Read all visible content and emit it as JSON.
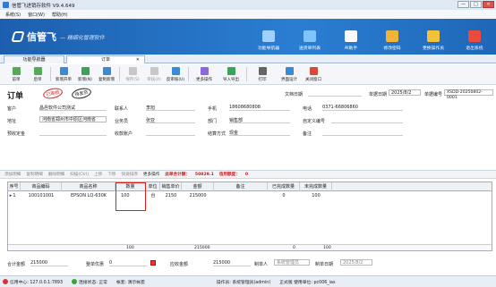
{
  "window": {
    "title": "信管飞进销存软件 V9.4.649",
    "min": "—",
    "max": "□",
    "close": "✕"
  },
  "menu": [
    "系统(S)",
    "窗口(W)",
    "帮助(H)"
  ],
  "banner": {
    "logo": "信管飞",
    "slogan": "— 精细化管理软件"
  },
  "topbuttons": [
    {
      "label": "功能导航器",
      "color": "#9fd0ff"
    },
    {
      "label": "送货单列表",
      "color": "#7fc3ff"
    },
    {
      "label": "AI助手",
      "color": "#ffffff"
    },
    {
      "label": "修改密码",
      "color": "#f3b23a"
    },
    {
      "label": "更换操作员",
      "color": "#f3c23a"
    },
    {
      "label": "退出系统",
      "color": "#e94b3c"
    }
  ],
  "tabs": [
    {
      "label": "功能导航器"
    },
    {
      "label": "订单",
      "close": "✕"
    }
  ],
  "toolbar": [
    {
      "label": "前单",
      "color": "#58a85a",
      "enabled": true
    },
    {
      "label": "后单",
      "color": "#58a85a",
      "enabled": true
    },
    {
      "label": "新增开单",
      "color": "#3a8ad6",
      "enabled": true
    },
    {
      "label": "新增(N)",
      "color": "#3aa35a",
      "enabled": true
    },
    {
      "label": "复制新增",
      "color": "#3a8ad6",
      "enabled": true
    },
    {
      "label": "保存(S)",
      "color": "#bbb",
      "enabled": false
    },
    {
      "label": "审核(A)",
      "color": "#bbb",
      "enabled": false
    },
    {
      "label": "反审核(U)",
      "color": "#3a8ad6",
      "enabled": true
    },
    {
      "label": "更多操作",
      "color": "#8a6ad6",
      "enabled": true
    },
    {
      "label": "导入导出",
      "color": "#3aa35a",
      "enabled": true
    },
    {
      "label": "打印",
      "color": "#666",
      "enabled": true
    },
    {
      "label": "界面设计",
      "color": "#3a8ad6",
      "enabled": true
    },
    {
      "label": "关闭窗口",
      "color": "#d64a3a",
      "enabled": true
    }
  ],
  "form": {
    "title": "订单",
    "stamp_status": "已审核",
    "stamp_type": "待发货",
    "doc_date_label": "文档日期",
    "doc_date_value": "",
    "bill_date_label": "单据日期",
    "bill_date_value": "2025/8/2",
    "bill_no_label": "单据编号",
    "bill_no_value": "XSDD-20250802-0001",
    "customer_label": "客户",
    "customer_value": "昌邑软件公司测试",
    "contact_label": "联系人",
    "contact_value": "李旭",
    "mobile_label": "手机",
    "mobile_value": "18608680808",
    "phone_label": "电话",
    "phone_value": "0371-66806860",
    "address_label": "地址",
    "address_value": "河南省郑州市中原区河南省",
    "salesman_label": "业务员",
    "salesman_value": "张亚",
    "dept_label": "部门",
    "dept_value": "销售部",
    "custom_no_label": "自定义编号",
    "custom_no_value": "",
    "prepay_label": "预收定金",
    "prepay_value": "",
    "account_label": "收款账户",
    "account_value": "",
    "settle_label": "结算方式",
    "settle_value": "现金",
    "remark_label": "备注",
    "remark_value": ""
  },
  "gridtoolbar": {
    "items": [
      "添加明细",
      "复制明细",
      "删除明细",
      "扫描(Ctrl)",
      "上移",
      "下移",
      "快速排序",
      "更多操作"
    ],
    "summary_label": "此单合计额：",
    "summary_value": "50829.1",
    "credit_label": "信用额度：",
    "credit_value": "0"
  },
  "table": {
    "headers": [
      "序号",
      "商品编码",
      "商品名称",
      "数量",
      "单位",
      "销售单价",
      "金额",
      "备注",
      "已完成数量",
      "未完成数量"
    ],
    "rows": [
      {
        "idx": "1",
        "code": "100101001",
        "name": "EPSON LQ-630K",
        "qty": "100",
        "unit": "台",
        "price": "2150",
        "amount": "215000",
        "remark": "",
        "done": "0",
        "undone": "100"
      }
    ],
    "footer": {
      "qty": "100",
      "amount": "215000",
      "done": "0",
      "undone": "100"
    }
  },
  "bottom": {
    "total_label": "合计金额",
    "total_value": "215000",
    "discount_label": "整单优惠",
    "discount_value": "0",
    "receivable_label": "应收金额",
    "receivable_value": "215000",
    "maker_label": "制单人",
    "maker_value": "系统管理员",
    "make_date_label": "制单日期",
    "make_date_value": "2025/8/2"
  },
  "status": {
    "app": "信用中心: 127.0.0.1:7893",
    "conn": "连接状态: 正常",
    "account": "帐套: 演示帐套",
    "operator": "操作员: 系统管理员(admin)",
    "version": "正式版 使用单位: pc006_ias"
  }
}
